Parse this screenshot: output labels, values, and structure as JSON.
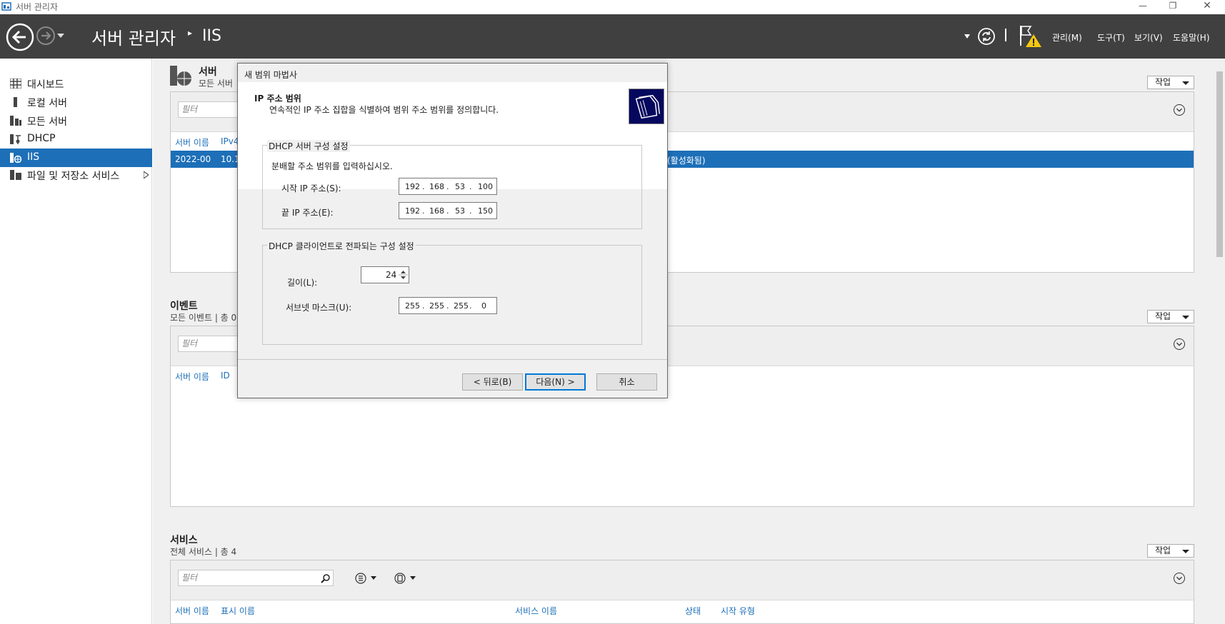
{
  "window": {
    "title": "서버 관리자"
  },
  "header": {
    "title": "서버 관리자",
    "page": "IIS",
    "menus": [
      "관리(M)",
      "도구(T)",
      "보기(V)",
      "도움말(H)"
    ]
  },
  "sidebar": {
    "items": [
      {
        "label": "대시보드"
      },
      {
        "label": "로컬 서버"
      },
      {
        "label": "모든 서버"
      },
      {
        "label": "DHCP"
      },
      {
        "label": "IIS"
      },
      {
        "label": "파일 및 저장소 서비스"
      }
    ]
  },
  "servers": {
    "title": "서버",
    "subtitle": "모든 서버",
    "action_label": "작업",
    "filter_placeholder": "필터",
    "columns": [
      "서버 이름",
      "IPv4"
    ],
    "row": {
      "name": "2022-00",
      "ip": "10.1",
      "status": "(활성화됨)"
    }
  },
  "events": {
    "title": "이벤트",
    "subtitle": "모든 이벤트 | 총 0",
    "action_label": "작업",
    "filter_placeholder": "필터",
    "columns": [
      "서버 이름",
      "ID"
    ]
  },
  "services": {
    "title": "서비스",
    "subtitle": "전체 서비스 | 총 4",
    "action_label": "작업",
    "filter_placeholder": "필터",
    "columns": [
      "서버 이름",
      "표시 이름",
      "서비스 이름",
      "상태",
      "시작 유형"
    ]
  },
  "dialog": {
    "title": "새 범위 마법사",
    "heading": "IP 주소 범위",
    "description": "연속적인 IP 주소 집합을 식별하여 범위 주소 범위를 정의합니다.",
    "server_group": {
      "title": "DHCP 서버 구성 설정",
      "instruction": "분배할 주소 범위를 입력하십시오.",
      "start_label": "시작 IP 주소(S):",
      "start_ip": [
        "192",
        "168",
        "53",
        "100"
      ],
      "end_label": "끝 IP 주소(E):",
      "end_ip": [
        "192",
        "168",
        "53",
        "150"
      ]
    },
    "client_group": {
      "title": "DHCP 클라이언트로 전파되는 구성 설정",
      "length_label": "길이(L):",
      "length_value": "24",
      "mask_label": "서브넷 마스크(U):",
      "mask": [
        "255",
        "255",
        "255",
        "0"
      ]
    },
    "buttons": {
      "back": "< 뒤로(B)",
      "next": "다음(N) >",
      "cancel": "취소"
    }
  },
  "colors": {
    "accent": "#1d6fb8",
    "header_bg": "#404040",
    "dialog_icon": "#06085e"
  }
}
